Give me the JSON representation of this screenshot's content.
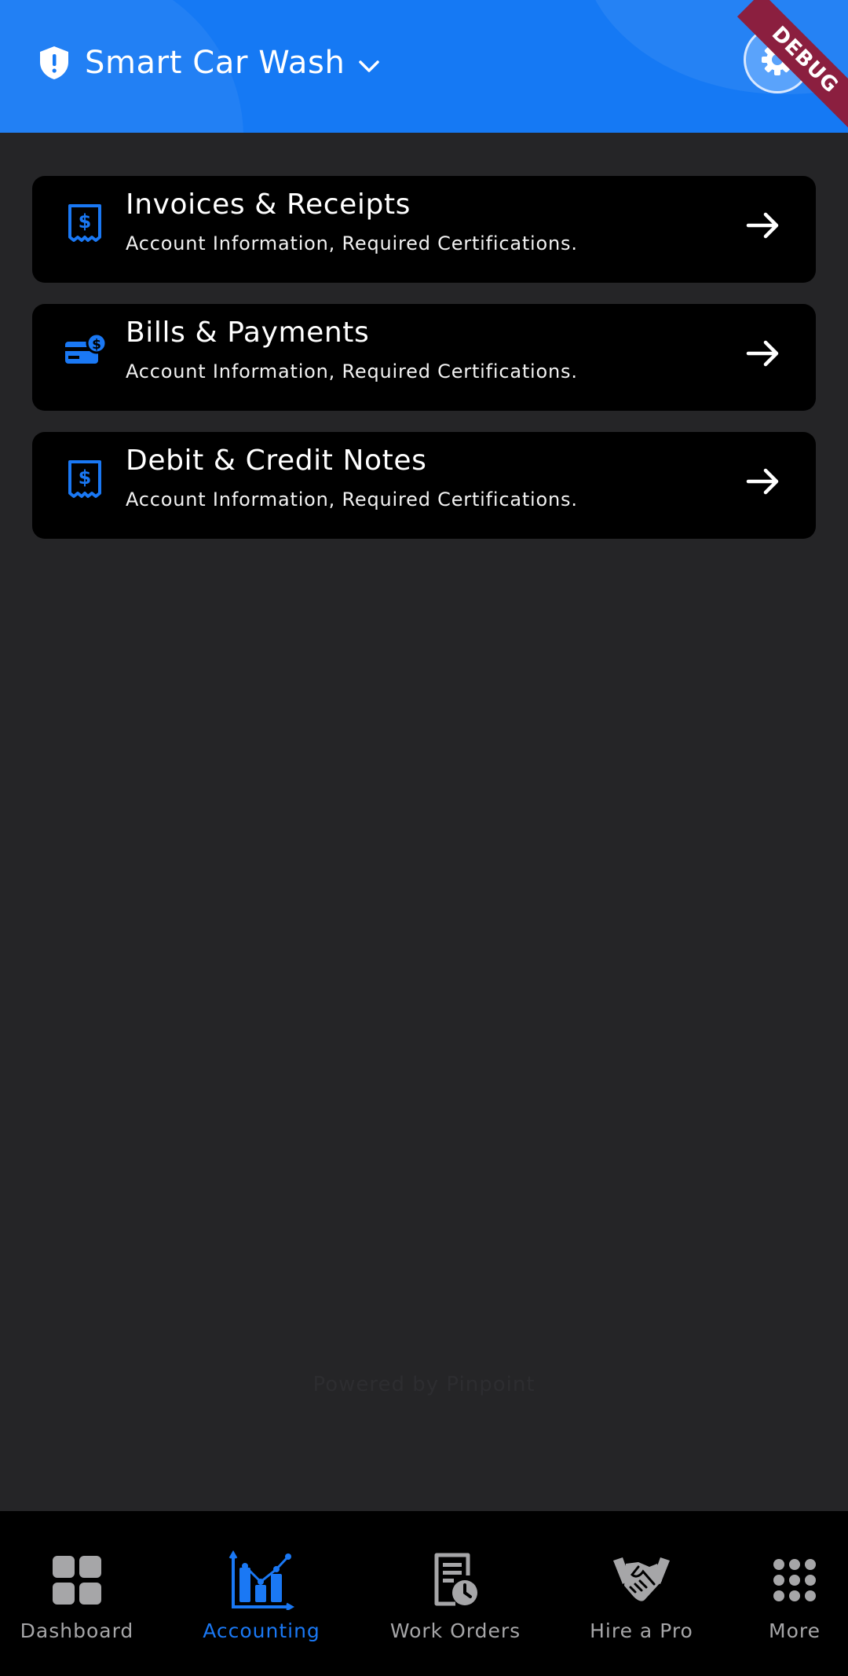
{
  "header": {
    "title": "Smart Car Wash",
    "debug_label": "DEBUG",
    "colors": {
      "primary": "#1579f4"
    }
  },
  "cards": [
    {
      "title": "Invoices & Receipts",
      "subtitle": "Account Information, Required Certifications.",
      "icon": "receipt-dollar-icon"
    },
    {
      "title": "Bills & Payments",
      "subtitle": "Account Information, Required Certifications.",
      "icon": "bill-payment-icon"
    },
    {
      "title": "Debit & Credit Notes",
      "subtitle": "Account Information, Required Certifications.",
      "icon": "receipt-dollar-icon"
    }
  ],
  "faint_text": "Powered by Pinpoint",
  "bottom_nav": {
    "active": "Accounting",
    "items": [
      {
        "label": "Dashboard",
        "icon": "dashboard-grid-icon"
      },
      {
        "label": "Accounting",
        "icon": "accounting-chart-icon"
      },
      {
        "label": "Work Orders",
        "icon": "work-orders-icon"
      },
      {
        "label": "Hire a Pro",
        "icon": "handshake-icon"
      },
      {
        "label": "More",
        "icon": "more-dots-icon"
      }
    ]
  }
}
